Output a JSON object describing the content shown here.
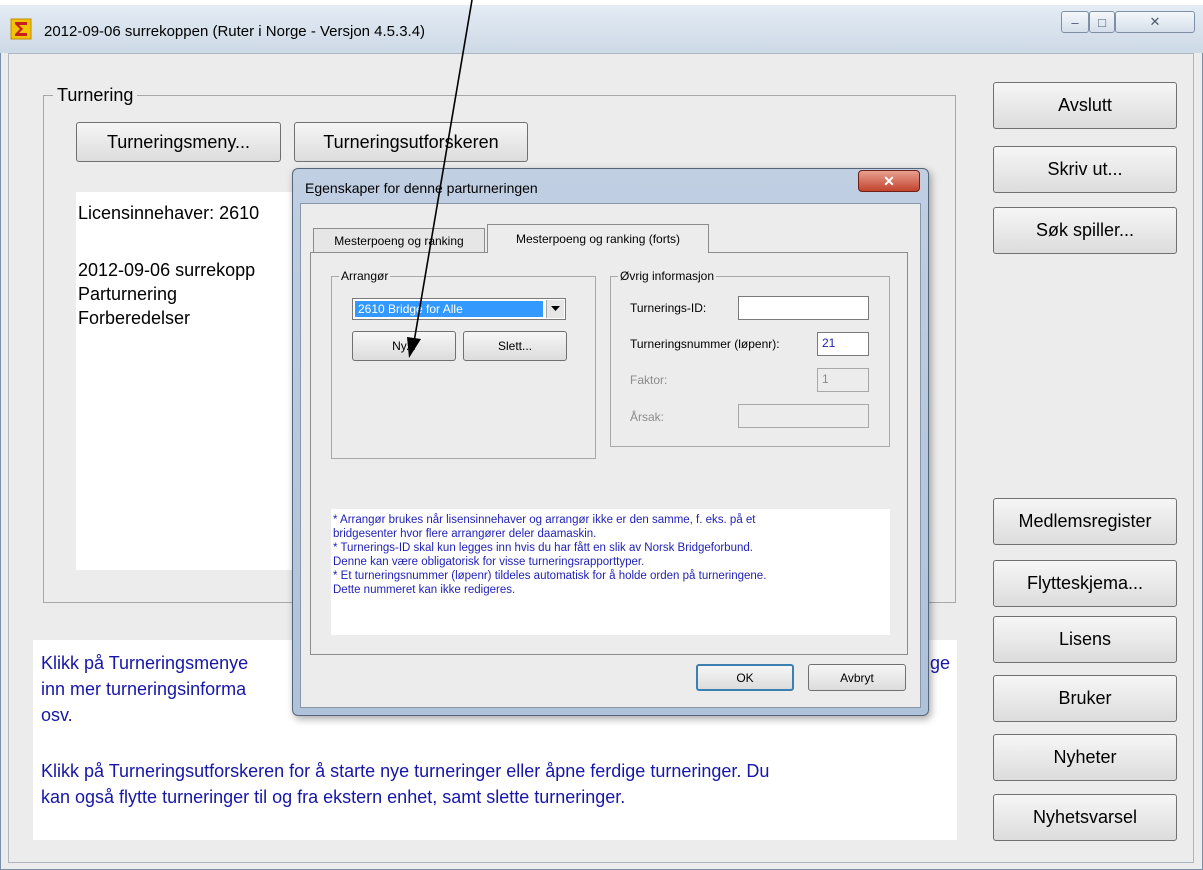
{
  "window": {
    "title": "2012-09-06  surrekoppen  (Ruter i Norge - Versjon 4.5.3.4)",
    "controls": {
      "minimize": "–",
      "maximize": "□",
      "close": "✕"
    }
  },
  "tournament_group": {
    "legend": "Turnering",
    "menu_button": "Turneringsmeny...",
    "explorer_button": "Turneringsutforskeren",
    "info": {
      "licensee": "Licensinnehaver: 2610",
      "tournament": "2012-09-06  surrekopp",
      "type": "Parturnering",
      "status": "Forberedelser"
    }
  },
  "help": {
    "line1": "Klikk på Turneringsmenye",
    "line1_end": "ge",
    "line2": "inn mer turneringsinforma",
    "line3": "osv.",
    "line4": "Klikk på Turneringsutforskeren for å starte nye turneringer eller åpne ferdige turneringer. Du",
    "line5": "kan også flytte turneringer til og fra ekstern enhet, samt slette turneringer."
  },
  "sidebar": {
    "top": [
      "Avslutt",
      "Skriv ut...",
      "Søk spiller..."
    ],
    "bottom": [
      "Medlemsregister",
      "Flytteskjema...",
      "Lisens",
      "Bruker",
      "Nyheter",
      "Nyhetsvarsel"
    ]
  },
  "dialog": {
    "title": "Egenskaper for denne parturneringen",
    "close": "✕",
    "tabs": [
      "Mesterpoeng og ranking",
      "Mesterpoeng og ranking (forts)"
    ],
    "arranger": {
      "legend": "Arrangør",
      "selected": "2610 Bridge for Alle",
      "new_button": "Ny...",
      "delete_button": "Slett..."
    },
    "other_info": {
      "legend": "Øvrig informasjon",
      "id_label": "Turnerings-ID:",
      "id_value": "",
      "number_label": "Turneringsnummer (løpenr):",
      "number_value": "21",
      "factor_label": "Faktor:",
      "factor_value": "1",
      "reason_label": "Årsak:",
      "reason_value": ""
    },
    "notes": [
      "* Arrangør brukes når lisensinnehaver og arrangør ikke er den samme, f. eks. på et",
      "bridgesenter hvor flere arrangører deler daamaskin.",
      "* Turnerings-ID skal kun legges inn hvis du har fått en slik av Norsk Bridgeforbund.",
      "Denne kan være obligatorisk for visse turneringsrapporttyper.",
      "* Et turneringsnummer (løpenr) tildeles automatisk for å holde orden på turneringene.",
      "Dette nummeret kan ikke redigeres."
    ],
    "ok_button": "OK",
    "cancel_button": "Avbryt"
  },
  "colors": {
    "help_text": "#1616a8",
    "note_text": "#1f1fb5",
    "selection": "#3399ff"
  }
}
